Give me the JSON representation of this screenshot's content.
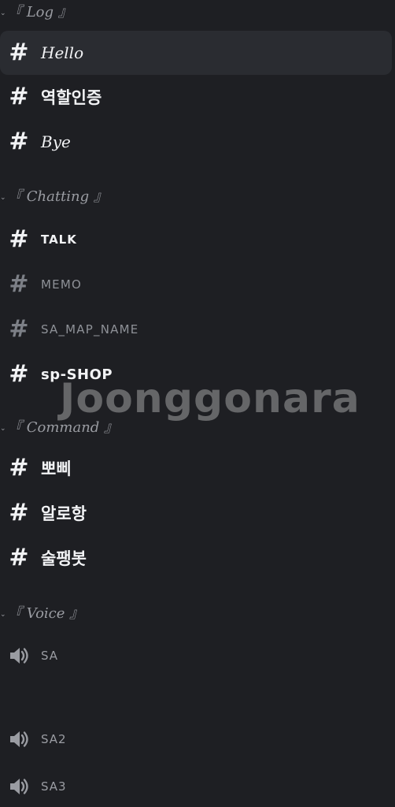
{
  "categories": {
    "log": "『 Log 』",
    "chatting": "『 Chatting 』",
    "command": "『 Command 』",
    "voice": "『 Voice 』"
  },
  "channels": {
    "log": [
      {
        "name": "Hello",
        "selected": true
      },
      {
        "name": "역할인증"
      },
      {
        "name": "Bye"
      }
    ],
    "chatting": [
      {
        "name": "TALK"
      },
      {
        "name": "MEMO"
      },
      {
        "name": "SA_MAP_NAME"
      },
      {
        "name": "sp-SHOP"
      }
    ],
    "command": [
      {
        "name": "뽀삐"
      },
      {
        "name": "알로항"
      },
      {
        "name": "술팽봇"
      }
    ],
    "voice": [
      {
        "name": "SA"
      },
      {
        "name": "SA2"
      },
      {
        "name": "SA3"
      }
    ]
  },
  "watermark": "Joonggonara",
  "icons": {
    "text_channel": "hash-icon",
    "voice_channel": "speaker-icon",
    "collapse": "chevron-down-icon"
  },
  "colors": {
    "background": "#1e1f23",
    "selected": "#2a2c31",
    "text": "#f2f3f5",
    "muted": "#8e9197"
  }
}
